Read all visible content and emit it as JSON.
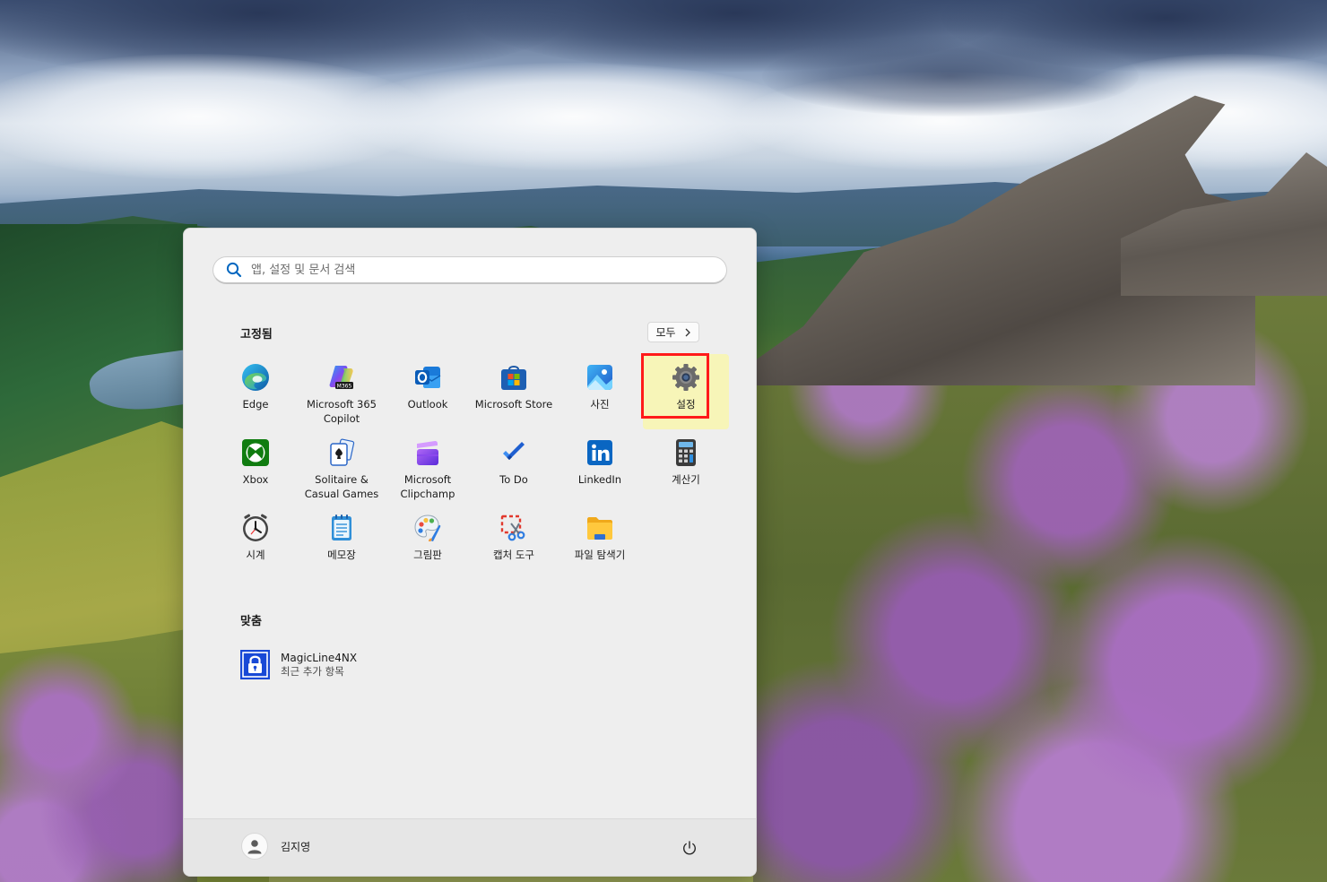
{
  "start_menu": {
    "search": {
      "placeholder": "앱, 설정 및 문서 검색",
      "value": ""
    },
    "pinned": {
      "title": "고정됨",
      "all_button_label": "모두",
      "apps": [
        {
          "label": "Edge",
          "icon": "edge-icon"
        },
        {
          "label": "Microsoft 365\nCopilot",
          "icon": "m365-copilot-icon"
        },
        {
          "label": "Outlook",
          "icon": "outlook-icon"
        },
        {
          "label": "Microsoft Store",
          "icon": "store-icon"
        },
        {
          "label": "사진",
          "icon": "photos-icon"
        },
        {
          "label": "설정",
          "icon": "settings-gear-icon",
          "highlighted": true
        },
        {
          "label": "Xbox",
          "icon": "xbox-icon"
        },
        {
          "label": "Solitaire &\nCasual Games",
          "icon": "solitaire-icon"
        },
        {
          "label": "Microsoft\nClipchamp",
          "icon": "clipchamp-icon"
        },
        {
          "label": "To Do",
          "icon": "todo-check-icon"
        },
        {
          "label": "LinkedIn",
          "icon": "linkedin-icon"
        },
        {
          "label": "계산기",
          "icon": "calculator-icon"
        },
        {
          "label": "시계",
          "icon": "clock-icon"
        },
        {
          "label": "메모장",
          "icon": "notepad-icon"
        },
        {
          "label": "그림판",
          "icon": "paint-palette-icon"
        },
        {
          "label": "캡처 도구",
          "icon": "snipping-tool-icon"
        },
        {
          "label": "파일 탐색기",
          "icon": "file-explorer-folder-icon"
        }
      ]
    },
    "recommended": {
      "title": "맞춤",
      "items": [
        {
          "name": "MagicLine4NX",
          "subtitle": "최근 추가 항목",
          "icon": "magicline-lock-icon"
        }
      ]
    },
    "footer": {
      "user_name": "김지영",
      "power_icon": "power-icon"
    }
  },
  "colors": {
    "highlight_border": "#ff1a1a",
    "highlight_fill": "#f7f5b8",
    "accent": "#0067c0"
  }
}
